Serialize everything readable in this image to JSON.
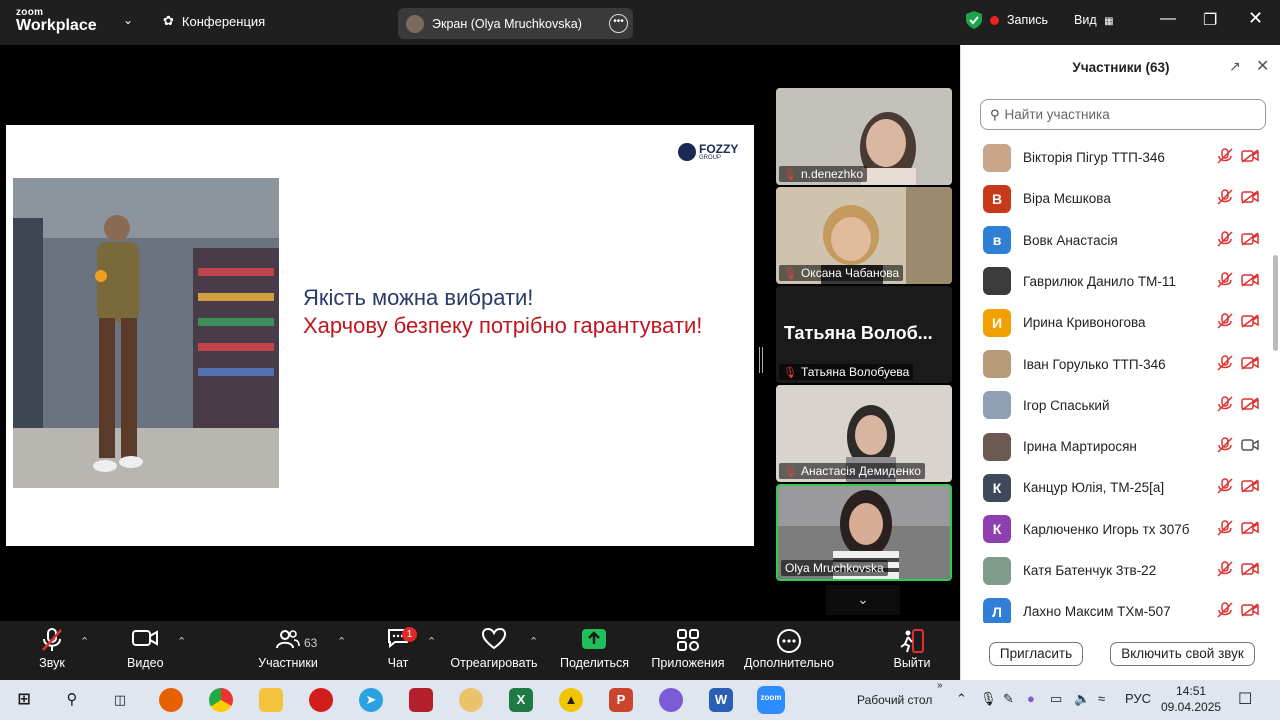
{
  "topbar": {
    "logo_line1": "zoom",
    "logo_line2": "Workplace",
    "conference_label": "Конференция",
    "screen_share_label": "Экран (Olya Mruchkovska)",
    "record_label": "Запись",
    "view_label": "Вид"
  },
  "slide": {
    "line1": "Якість можна вибрати!",
    "line2": "Харчову безпеку потрібно гарантувати!",
    "brand": "FOZZY",
    "brand_sub": "GROUP"
  },
  "videos": [
    {
      "name": "n.denezhko",
      "muted": true
    },
    {
      "name": "Оксана Чабанова",
      "muted": true
    },
    {
      "name": "Татьяна Волобуева",
      "big_name": "Татьяна  Волоб...",
      "muted": true
    },
    {
      "name": "Анастасія Демиденко",
      "muted": true
    },
    {
      "name": "Olya Mruchkovska",
      "muted": false,
      "active_speaker": true
    }
  ],
  "toolbar": {
    "audio": "Звук",
    "video": "Видео",
    "participants": "Участники",
    "participants_count": "63",
    "chat": "Чат",
    "chat_badge": "1",
    "react": "Отреагировать",
    "share": "Поделиться",
    "apps": "Приложения",
    "more": "Дополнительно",
    "leave": "Выйти"
  },
  "panel": {
    "title": "Участники (63)",
    "search_placeholder": "Найти участника",
    "invite_label": "Пригласить",
    "unmute_label": "Включить свой звук",
    "participants": [
      {
        "name": "Вікторія Пігур ТТП-346",
        "avatar_letter": "",
        "avatar_color": "#c9a58a",
        "video_on": false
      },
      {
        "name": "Віра Мєшкова",
        "avatar_letter": "В",
        "avatar_color": "#c8381a",
        "video_on": false
      },
      {
        "name": "Вовк Анастасія",
        "avatar_letter": "в",
        "avatar_color": "#2f7fd6",
        "video_on": false
      },
      {
        "name": "Гаврилюк Данило ТМ-11",
        "avatar_letter": "",
        "avatar_color": "#3b3b3b",
        "video_on": false
      },
      {
        "name": "Ирина Кривоногова",
        "avatar_letter": "И",
        "avatar_color": "#f0a000",
        "video_on": false
      },
      {
        "name": "Іван Горулько ТТП-346",
        "avatar_letter": "",
        "avatar_color": "#b59b78",
        "video_on": false
      },
      {
        "name": "Ігор Спаський",
        "avatar_letter": "",
        "avatar_color": "#8fa0b4",
        "video_on": false
      },
      {
        "name": "Ірина Мартиросян",
        "avatar_letter": "",
        "avatar_color": "#6c5a52",
        "video_on": true
      },
      {
        "name": "Канцур Юлія, ТМ-25[а]",
        "avatar_letter": "К",
        "avatar_color": "#3e4a5c",
        "video_on": false
      },
      {
        "name": "Карлюченко Игорь тх 307б",
        "avatar_letter": "К",
        "avatar_color": "#8e3fb0",
        "video_on": false
      },
      {
        "name": "Катя Батенчук 3тв-22",
        "avatar_letter": "",
        "avatar_color": "#7d9c8b",
        "video_on": false
      },
      {
        "name": "Лахно Максим ТХм-507",
        "avatar_letter": "Л",
        "avatar_color": "#2f7fd6",
        "video_on": false
      }
    ]
  },
  "taskbar": {
    "desktop_label": "Рабочий стол",
    "lang": "РУС",
    "time": "14:51",
    "date": "09.04.2025"
  }
}
